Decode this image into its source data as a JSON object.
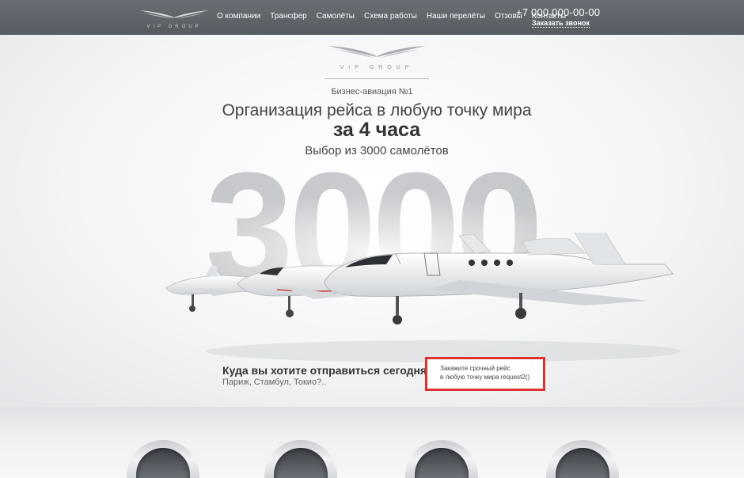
{
  "nav": {
    "logo_text": "VIP GROUP",
    "items": [
      "О компании",
      "Трансфер",
      "Самолёты",
      "Схема работы",
      "Наши перелёты",
      "Отзовы",
      "Контакты"
    ],
    "phone": "+7 000 000-00-00",
    "callback": "Заказать звонок"
  },
  "hero": {
    "logo_text": "VIP GROUP",
    "kicker": "Бизнес-авиация №1",
    "headline": "Организация рейса в любую точку мира",
    "headline_bold": "за 4 часа",
    "subline": "Выбор из 3000 самолётов",
    "big_number": "3000",
    "question": "Куда вы хотите отправиться сегодня?",
    "question_sub": "Париж, Стамбул, Токио?..",
    "order_line1": "Закажите срочный рейс",
    "order_line2": "в любую точку мира request2()"
  },
  "colors": {
    "topbar": "#5f6469",
    "accent_border": "#d9342f"
  }
}
